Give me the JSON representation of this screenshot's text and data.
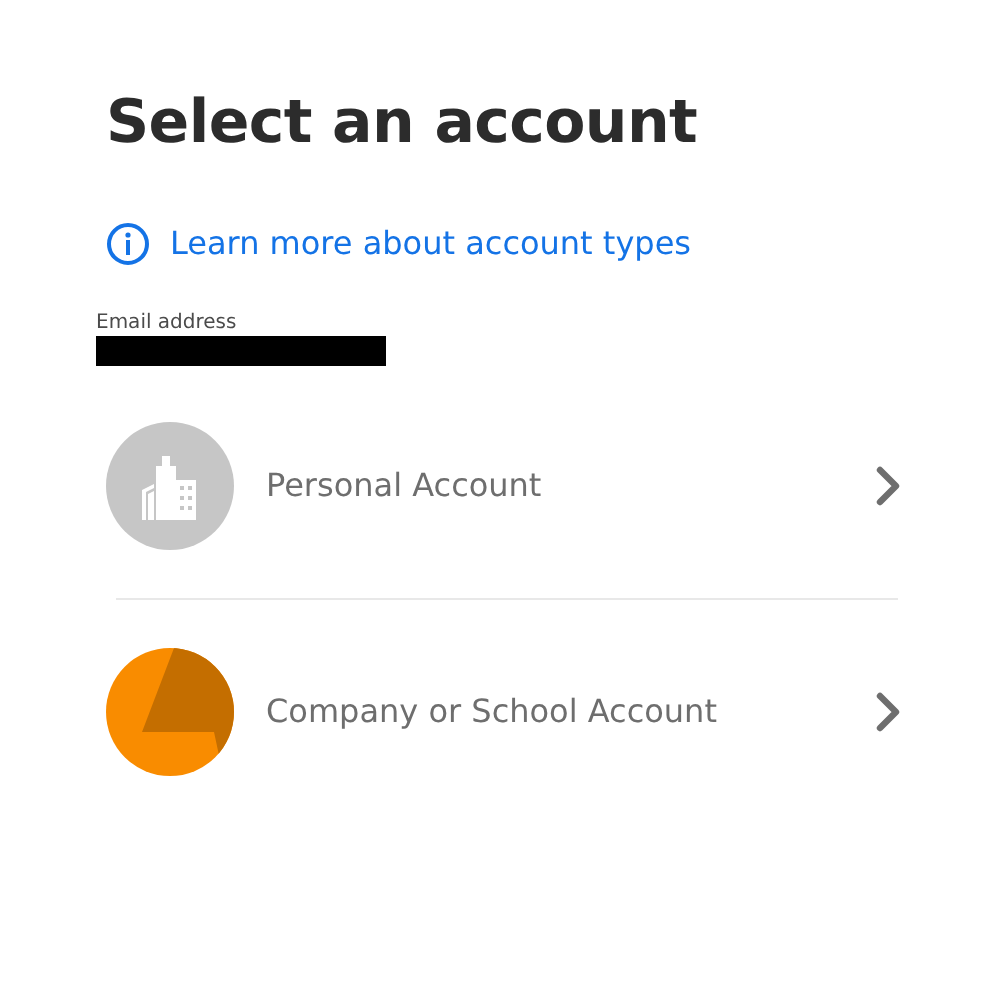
{
  "title": "Select an account",
  "help_link": {
    "label": "Learn more about account types"
  },
  "email": {
    "label": "Email address",
    "redacted": true
  },
  "accounts": [
    {
      "kind": "personal",
      "label": "Personal Account"
    },
    {
      "kind": "company",
      "label": "Company or School Account"
    }
  ]
}
